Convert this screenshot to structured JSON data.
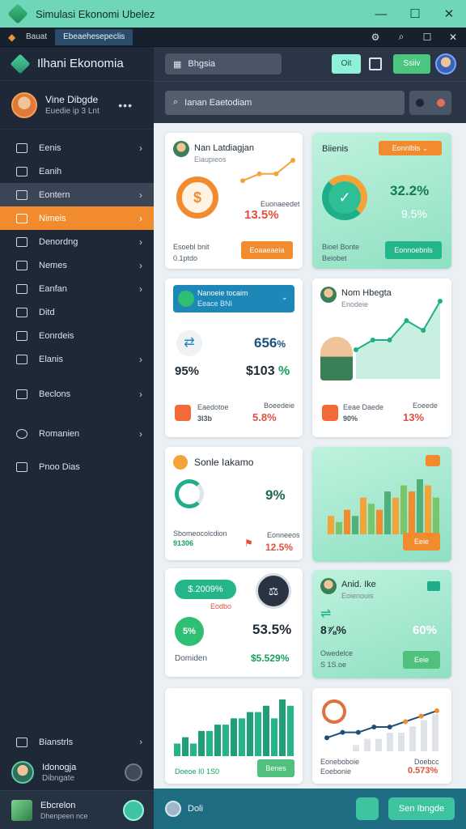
{
  "window": {
    "title": "Simulasi Ekonomi Ubelez"
  },
  "menubar": {
    "item1": "Bauat",
    "tab": "Ebeaehesepeclis"
  },
  "sidebar": {
    "brand": "Ilhani Ekonomia",
    "profile": {
      "name": "Vine Dibgde",
      "sub": "Euedie ip 3 Lnt"
    },
    "items": [
      {
        "label": "Eenis",
        "chevron": true
      },
      {
        "label": "Eanih",
        "chevron": false
      },
      {
        "label": "Eontern",
        "chevron": true
      },
      {
        "label": "Nimeis",
        "chevron": true
      },
      {
        "label": "Denordng",
        "chevron": true
      },
      {
        "label": "Nemes",
        "chevron": true
      },
      {
        "label": "Eanfan",
        "chevron": true
      },
      {
        "label": "Ditd",
        "chevron": false
      },
      {
        "label": "Eonrdeis",
        "chevron": false
      },
      {
        "label": "Elanis",
        "chevron": true
      }
    ],
    "items2": [
      {
        "label": "Beclons"
      },
      {
        "label": "Romanien"
      },
      {
        "label": "Pnoo Dias"
      }
    ],
    "bottom": {
      "row": "Bianstrls",
      "user_name": "Idonogja",
      "user_sub": "Dibngate",
      "footer_name": "Ebcrelon",
      "footer_sub": "Dhenpeen nce"
    }
  },
  "header": {
    "search": "Bhgsia",
    "btn1": "Oit",
    "btn3": "Ssiiv",
    "search2": "Ianan Eaetodiam"
  },
  "cards": {
    "c1": {
      "title": "Nan Latdiagjan",
      "sub": "Eiaupieos",
      "pct": "13.5%",
      "small1": "Euonaeedet",
      "foot1": "Esoebl bnit",
      "foot2": "0.1ptdo",
      "btn": "Eoaaeaeia"
    },
    "c2": {
      "title": "Biienis",
      "dropdown": "Eonnlbls",
      "pct1": "32.2%",
      "pct2": "9.5%",
      "foot1": "Bioel Bonte",
      "foot2": "Beiobet",
      "btn": "Eonnoebnls"
    },
    "c3": {
      "header": "Nanoeie tocaim",
      "header_sub": "Eeace BNI",
      "val1": "656",
      "val1_unit": "%",
      "val2": "95%",
      "val3": "$103",
      "val3_unit": "%",
      "foot1": "Eaedotoe",
      "foot2": "3I3b",
      "foot3": "Boeedeie",
      "pct": "5.8%"
    },
    "c4": {
      "title": "Nom Hbegta",
      "sub": "Enodeie",
      "foot1": "Eeae Daede",
      "foot2": "90%",
      "foot3": "Eoeede",
      "pct": "13%"
    },
    "c5": {
      "title": "Sonle Iakamo",
      "val": "9%",
      "foot1": "Sbomeocolcdion",
      "foot1v": "91306",
      "foot2": "Eonneeos",
      "pct": "12.5%"
    },
    "c6": {
      "btn": "Eeie"
    },
    "c7": {
      "pill": "$.2009%",
      "pill_sub": "Eodbo",
      "badge": "5%",
      "pct": "53.5%",
      "foot1": "Domiden",
      "foot2": "$5.529%"
    },
    "c8": {
      "title": "Anid. Ike",
      "sub": "Eoienouis",
      "val1": "8⅞%",
      "val2": "60%",
      "foot1": "Owedelce",
      "foot2": "S 1S.oe",
      "btn": "Eeie"
    },
    "c9": {
      "foot": "Doeoe I0 1S0",
      "btn": "Benes"
    },
    "c10": {
      "foot1": "Eoneboboie",
      "foot2": "Eoebonie",
      "foot3": "Doebcc",
      "pct": "0.573%"
    }
  },
  "bottombar": {
    "label": "Doli",
    "btn": "Sen Ibngde"
  },
  "colors": {
    "accent_orange": "#f28a2e",
    "accent_green": "#25b58a",
    "sidebar_bg": "#1e2836",
    "titlebar": "#6fd6b8"
  },
  "chart_data": [
    {
      "type": "line",
      "title": "",
      "series": [
        {
          "values": [
            2,
            3,
            3,
            5
          ]
        }
      ]
    },
    {
      "type": "area",
      "title": "",
      "series": [
        {
          "values": [
            3,
            4,
            4,
            6,
            5,
            8
          ]
        }
      ]
    },
    {
      "type": "bar",
      "title": "",
      "values": [
        3,
        2,
        4,
        3,
        6,
        5,
        4,
        7,
        6,
        8,
        7,
        9,
        8,
        6
      ]
    },
    {
      "type": "bar",
      "title": "",
      "values": [
        2,
        3,
        2,
        4,
        4,
        5,
        5,
        6,
        6,
        7,
        7,
        8,
        6,
        9,
        8
      ]
    },
    {
      "type": "line",
      "title": "",
      "series": [
        {
          "values": [
            1,
            2,
            2,
            3,
            3,
            4,
            5,
            6
          ]
        }
      ]
    }
  ]
}
